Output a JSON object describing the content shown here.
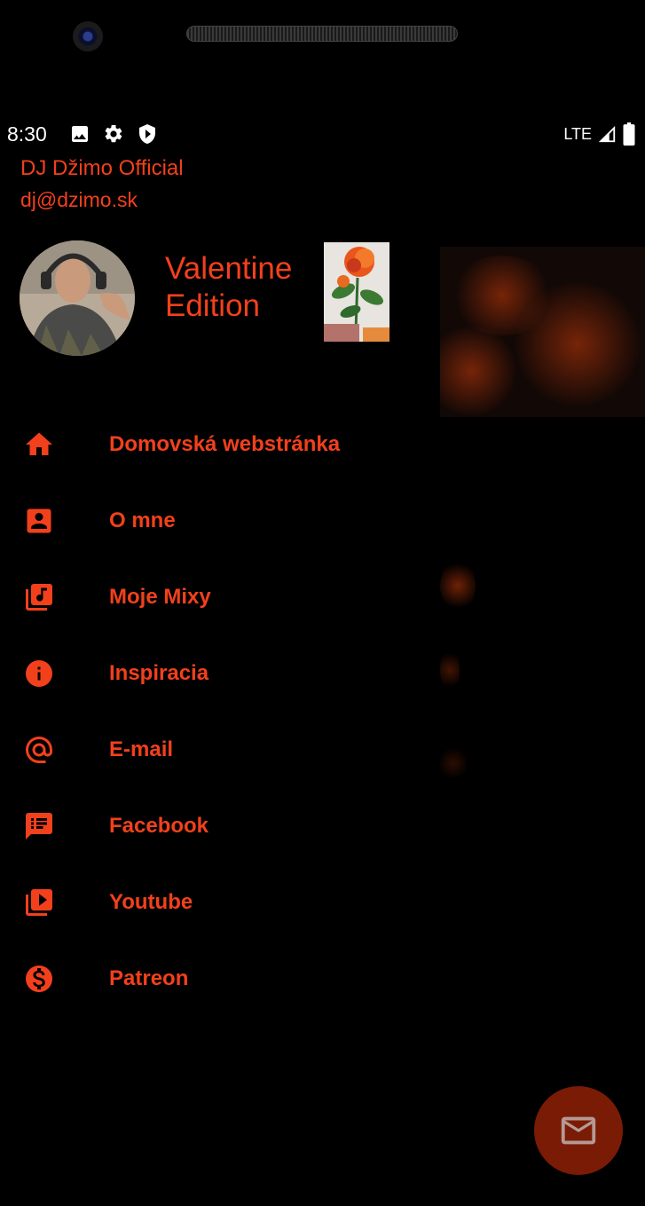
{
  "status_bar": {
    "time": "8:30",
    "network": "LTE",
    "icons": [
      "image-icon",
      "settings-icon",
      "shield-play-icon",
      "signal-icon",
      "battery-icon"
    ]
  },
  "header": {
    "app_name": "DJ Džimo Official",
    "email": "dj@dzimo.sk",
    "edition_line1": "Valentine",
    "edition_line2": "Edition"
  },
  "menu": {
    "items": [
      {
        "label": "Domovská webstránka",
        "icon": "home-icon"
      },
      {
        "label": "O mne",
        "icon": "contact-icon"
      },
      {
        "label": "Moje Mixy",
        "icon": "music-library-icon"
      },
      {
        "label": "Inspiracia",
        "icon": "info-icon"
      },
      {
        "label": "E-mail",
        "icon": "at-icon"
      },
      {
        "label": "Facebook",
        "icon": "message-list-icon"
      },
      {
        "label": "Youtube",
        "icon": "video-library-icon"
      },
      {
        "label": "Patreon",
        "icon": "dollar-icon"
      }
    ]
  },
  "colors": {
    "accent": "#f2401c",
    "background": "#000000",
    "fab": "#7a1b06"
  },
  "fab": {
    "icon": "mail-icon"
  }
}
